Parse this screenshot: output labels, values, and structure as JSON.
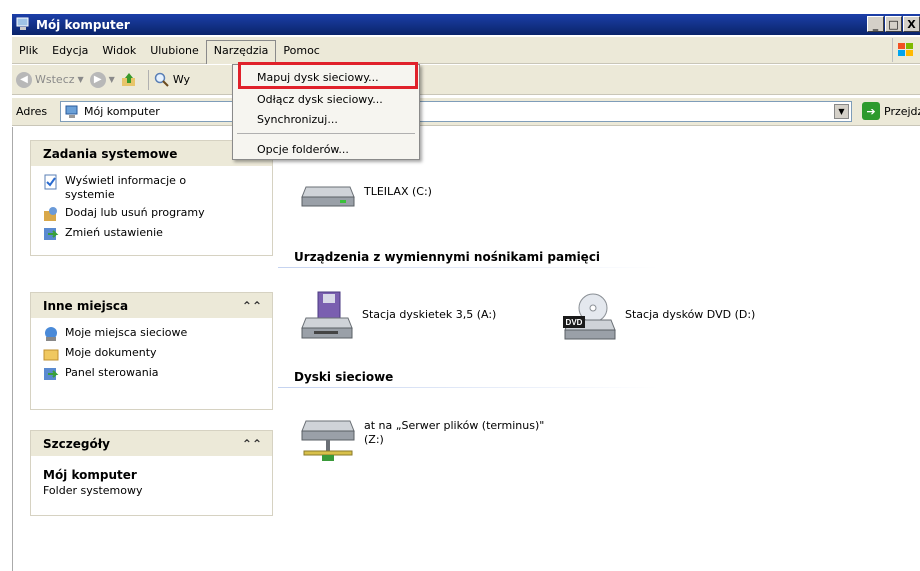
{
  "window": {
    "title": "Mój komputer",
    "btn_min": "_",
    "btn_max": "□",
    "btn_close": "X"
  },
  "menubar": {
    "items": [
      "Plik",
      "Edycja",
      "Widok",
      "Ulubione",
      "Narzędzia",
      "Pomoc"
    ]
  },
  "toolbar": {
    "back_label": "Wstecz",
    "search_partial": "Wy"
  },
  "address": {
    "label": "Adres",
    "value": "Mój komputer",
    "go_label": "Przejdź"
  },
  "dropdown": {
    "items": [
      "Mapuj dysk sieciowy...",
      "Odłącz dysk sieciowy...",
      "Synchronizuj...",
      "Opcje folderów..."
    ]
  },
  "tasks": {
    "system": {
      "title": "Zadania systemowe",
      "items": [
        "Wyświetl informacje o systemie",
        "Dodaj lub usuń programy",
        "Zmień ustawienie"
      ]
    },
    "places": {
      "title": "Inne miejsca",
      "items": [
        "Moje miejsca sieciowe",
        "Moje dokumenty",
        "Panel sterowania"
      ]
    },
    "details": {
      "title": "Szczegóły",
      "name": "Mój komputer",
      "desc": "Folder systemowy"
    }
  },
  "main": {
    "hdd_label": "TLEILAX (C:)",
    "removable_title": "Urządzenia z wymiennymi nośnikami pamięci",
    "floppy_label": "Stacja dyskietek 3,5 (A:)",
    "dvd_label": "Stacja dysków DVD (D:)",
    "dvd_badge": "DVD",
    "network_title": "Dyski sieciowe",
    "network_label_line1": "at na „Serwer plików (terminus)\"",
    "network_label_line2": "(Z:)"
  },
  "colors": {
    "highlight": "#e0212b",
    "title_bg": "#0a246a"
  }
}
